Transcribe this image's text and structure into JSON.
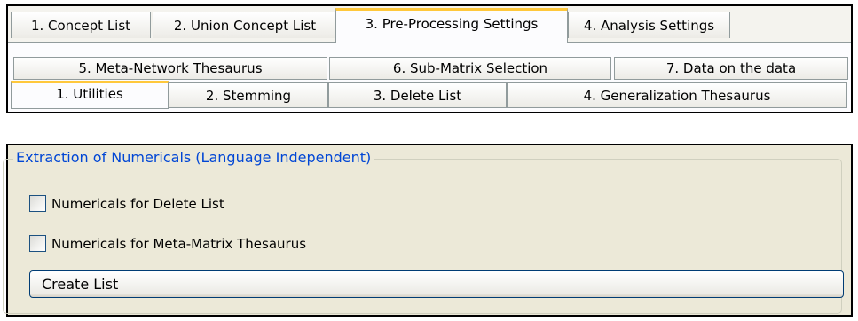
{
  "top_tabs": [
    {
      "label": "1. Concept List"
    },
    {
      "label": "2. Union Concept List"
    },
    {
      "label": "3. Pre-Processing Settings",
      "selected": true
    },
    {
      "label": "4. Analysis Settings"
    }
  ],
  "sub_tabs_row1": [
    {
      "label": "5. Meta-Network Thesaurus"
    },
    {
      "label": "6. Sub-Matrix Selection"
    },
    {
      "label": "7. Data on the data"
    }
  ],
  "sub_tabs_row2": [
    {
      "label": "1. Utilities",
      "selected": true
    },
    {
      "label": "2. Stemming"
    },
    {
      "label": "3. Delete List"
    },
    {
      "label": "4. Generalization Thesaurus"
    }
  ],
  "group": {
    "title": "Extraction of Numericals (Language Independent)",
    "checkboxes": [
      {
        "label": "Numericals for Delete List",
        "checked": false
      },
      {
        "label": "Numericals for Meta-Matrix Thesaurus",
        "checked": false
      }
    ],
    "button_label": "Create List"
  },
  "colors": {
    "selected_tab_accent": "#ffc83c",
    "group_title": "#0046d5",
    "panel_background": "#ece9d8"
  }
}
